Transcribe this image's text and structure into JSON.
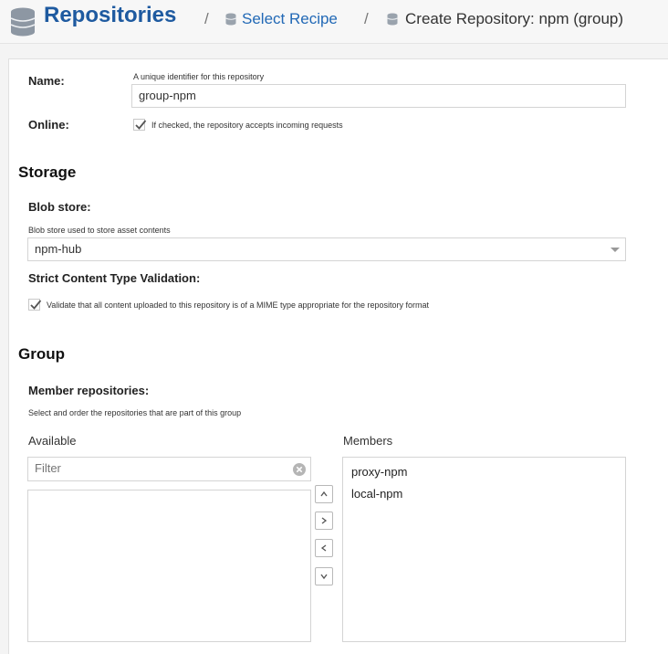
{
  "breadcrumb": {
    "title": "Repositories",
    "separator": "/",
    "select_recipe": "Select Recipe",
    "current": "Create Repository: npm (group)"
  },
  "form": {
    "name": {
      "label": "Name:",
      "help": "A unique identifier for this repository",
      "value": "group-npm"
    },
    "online": {
      "label": "Online:",
      "checked": true,
      "help": "If checked, the repository accepts incoming requests"
    }
  },
  "storage": {
    "title": "Storage",
    "blob_store": {
      "label": "Blob store:",
      "help": "Blob store used to store asset contents",
      "value": "npm-hub"
    },
    "strict": {
      "label": "Strict Content Type Validation:",
      "checked": true,
      "help": "Validate that all content uploaded to this repository is of a MIME type appropriate for the repository format"
    }
  },
  "group": {
    "title": "Group",
    "member_repositories": {
      "label": "Member repositories:",
      "help": "Select and order the repositories that are part of this group"
    },
    "available": {
      "label": "Available",
      "filter_placeholder": "Filter",
      "items": []
    },
    "members": {
      "label": "Members",
      "items": [
        "proxy-npm",
        "local-npm"
      ]
    },
    "buttons": [
      "move-up",
      "add",
      "remove",
      "move-down"
    ]
  },
  "colors": {
    "brand": "#1e5aa0",
    "link": "#2269b6"
  }
}
